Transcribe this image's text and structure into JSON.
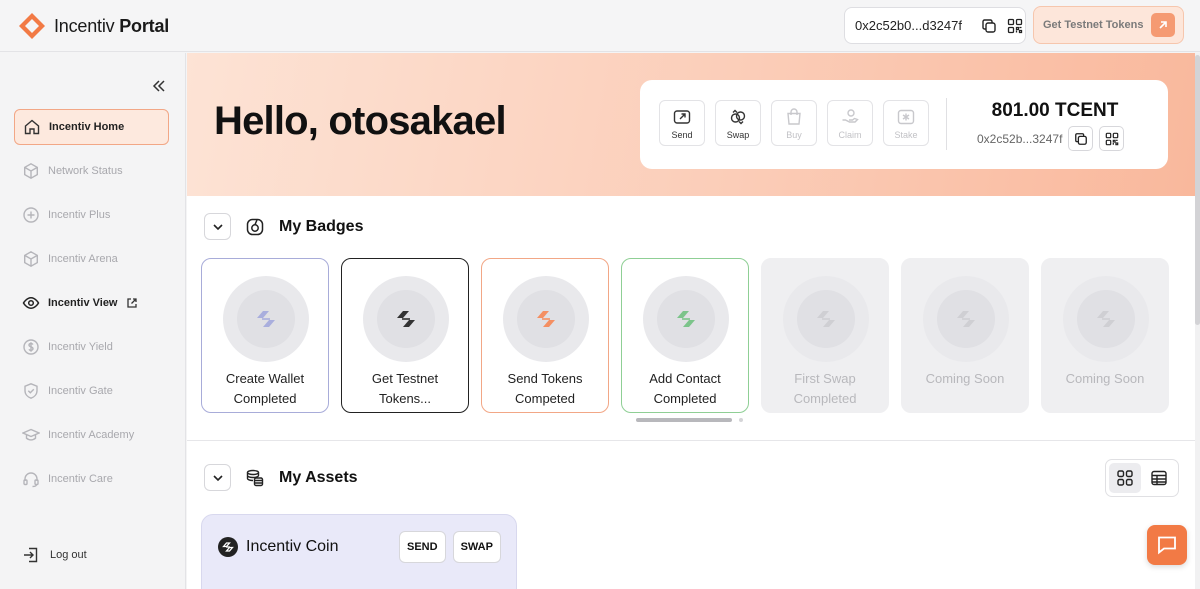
{
  "header": {
    "logo_text_light": "Incentiv",
    "logo_text_bold": "Portal",
    "wallet_address": "0x2c52b0...d3247f",
    "testnet_button": "Get Testnet Tokens"
  },
  "sidebar": {
    "items": [
      {
        "label": "Incentiv Home",
        "icon": "home-icon",
        "state": "active"
      },
      {
        "label": "Network Status",
        "icon": "cube-icon",
        "state": "disabled"
      },
      {
        "label": "Incentiv Plus",
        "icon": "plus-circle-icon",
        "state": "disabled"
      },
      {
        "label": "Incentiv Arena",
        "icon": "cube-icon",
        "state": "disabled"
      },
      {
        "label": "Incentiv View",
        "icon": "eye-icon",
        "state": "enabled"
      },
      {
        "label": "Incentiv Yield",
        "icon": "dollar-icon",
        "state": "disabled"
      },
      {
        "label": "Incentiv Gate",
        "icon": "shield-icon",
        "state": "disabled"
      },
      {
        "label": "Incentiv Academy",
        "icon": "graduation-cap-icon",
        "state": "disabled"
      },
      {
        "label": "Incentiv Care",
        "icon": "headset-icon",
        "state": "disabled"
      }
    ],
    "logout": "Log out"
  },
  "hero": {
    "greeting": "Hello, otosakael",
    "actions": [
      {
        "label": "Send",
        "enabled": true
      },
      {
        "label": "Swap",
        "enabled": true
      },
      {
        "label": "Buy",
        "enabled": false
      },
      {
        "label": "Claim",
        "enabled": false
      },
      {
        "label": "Stake",
        "enabled": false
      }
    ],
    "balance": "801.00 TCENT",
    "balance_address": "0x2c52b...3247f"
  },
  "badges_section": {
    "title": "My Badges",
    "badges": [
      {
        "label": "Create Wallet Completed",
        "border": "#a8acd9",
        "accent": "#a9aedd",
        "locked": false
      },
      {
        "label": "Get Testnet Tokens...",
        "border": "#222222",
        "accent": "#333333",
        "locked": false
      },
      {
        "label": "Send Tokens Competed",
        "border": "#f2a786",
        "accent": "#f48f62",
        "locked": false
      },
      {
        "label": "Add Contact Completed",
        "border": "#8fcf95",
        "accent": "#7cc48a",
        "locked": false
      },
      {
        "label": "First Swap Completed",
        "border": "#efeff1",
        "accent": "#cfcfd3",
        "locked": true
      },
      {
        "label": "Coming Soon",
        "border": "#efeff1",
        "accent": "#cfcfd3",
        "locked": true
      },
      {
        "label": "Coming Soon",
        "border": "#efeff1",
        "accent": "#cfcfd3",
        "locked": true
      }
    ]
  },
  "assets_section": {
    "title": "My Assets",
    "asset": {
      "name": "Incentiv Coin",
      "send": "SEND",
      "swap": "SWAP"
    }
  },
  "colors": {
    "brand": "#f27a45",
    "hero_start": "#fde3d5",
    "hero_end": "#f9b89c"
  }
}
